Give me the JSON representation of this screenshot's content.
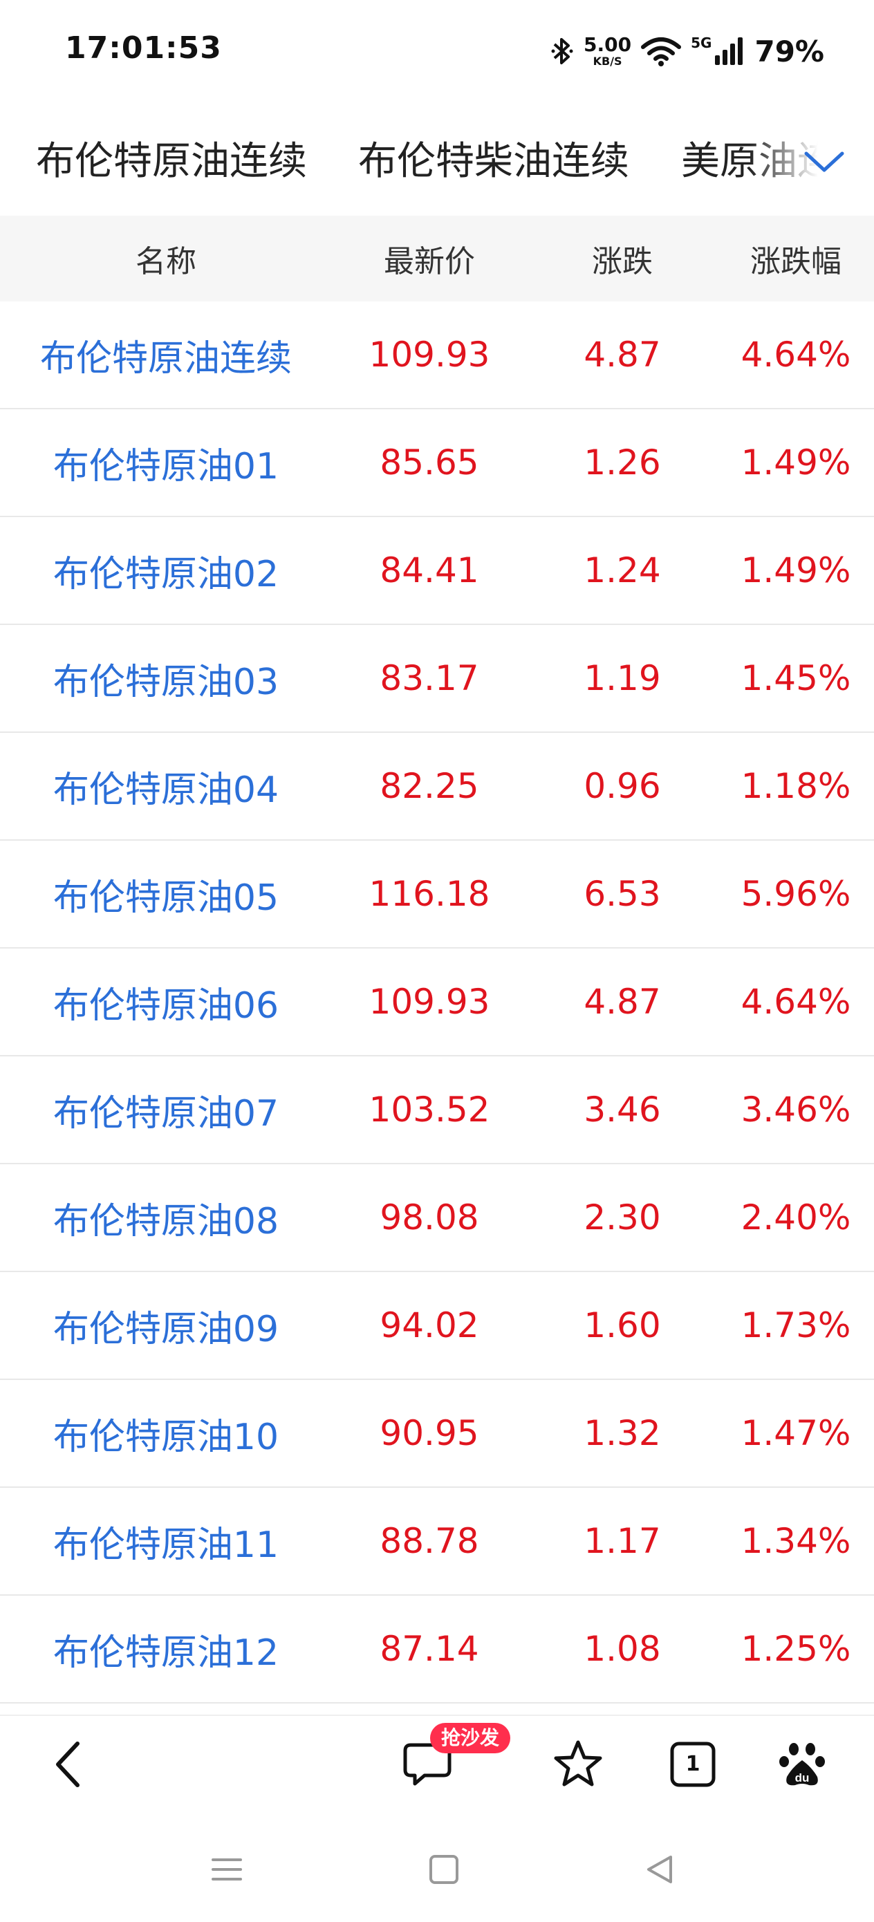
{
  "status_bar": {
    "time": "17:01:53",
    "net_speed_value": "5.00",
    "net_speed_unit": "KB/S",
    "network_type": "5G",
    "battery": "79%"
  },
  "tabs": [
    "布伦特原油连续",
    "布伦特柴油连续",
    "美原油连"
  ],
  "table": {
    "headers": [
      "名称",
      "最新价",
      "涨跌",
      "涨跌幅"
    ],
    "rows": [
      {
        "name": "布伦特原油连续",
        "price": "109.93",
        "change": "4.87",
        "pct": "4.64%"
      },
      {
        "name": "布伦特原油01",
        "price": "85.65",
        "change": "1.26",
        "pct": "1.49%"
      },
      {
        "name": "布伦特原油02",
        "price": "84.41",
        "change": "1.24",
        "pct": "1.49%"
      },
      {
        "name": "布伦特原油03",
        "price": "83.17",
        "change": "1.19",
        "pct": "1.45%"
      },
      {
        "name": "布伦特原油04",
        "price": "82.25",
        "change": "0.96",
        "pct": "1.18%"
      },
      {
        "name": "布伦特原油05",
        "price": "116.18",
        "change": "6.53",
        "pct": "5.96%"
      },
      {
        "name": "布伦特原油06",
        "price": "109.93",
        "change": "4.87",
        "pct": "4.64%"
      },
      {
        "name": "布伦特原油07",
        "price": "103.52",
        "change": "3.46",
        "pct": "3.46%"
      },
      {
        "name": "布伦特原油08",
        "price": "98.08",
        "change": "2.30",
        "pct": "2.40%"
      },
      {
        "name": "布伦特原油09",
        "price": "94.02",
        "change": "1.60",
        "pct": "1.73%"
      },
      {
        "name": "布伦特原油10",
        "price": "90.95",
        "change": "1.32",
        "pct": "1.47%"
      },
      {
        "name": "布伦特原油11",
        "price": "88.78",
        "change": "1.17",
        "pct": "1.34%"
      },
      {
        "name": "布伦特原油12",
        "price": "87.14",
        "change": "1.08",
        "pct": "1.25%"
      }
    ]
  },
  "toolbar": {
    "sofa_badge": "抢沙发",
    "tab_count": "1"
  },
  "colors": {
    "name_blue": "#2b6fd8",
    "value_red": "#e0141e",
    "badge_red": "#ff2e4d",
    "header_bg": "#f6f6f6"
  },
  "icons": [
    "bluetooth-icon",
    "wifi-icon",
    "signal-icon",
    "chevron-down-icon",
    "back-arrow-icon",
    "comment-icon",
    "star-icon",
    "tab-count-icon",
    "baidu-paw-icon",
    "menu-icon",
    "home-icon",
    "back-triangle-icon"
  ]
}
